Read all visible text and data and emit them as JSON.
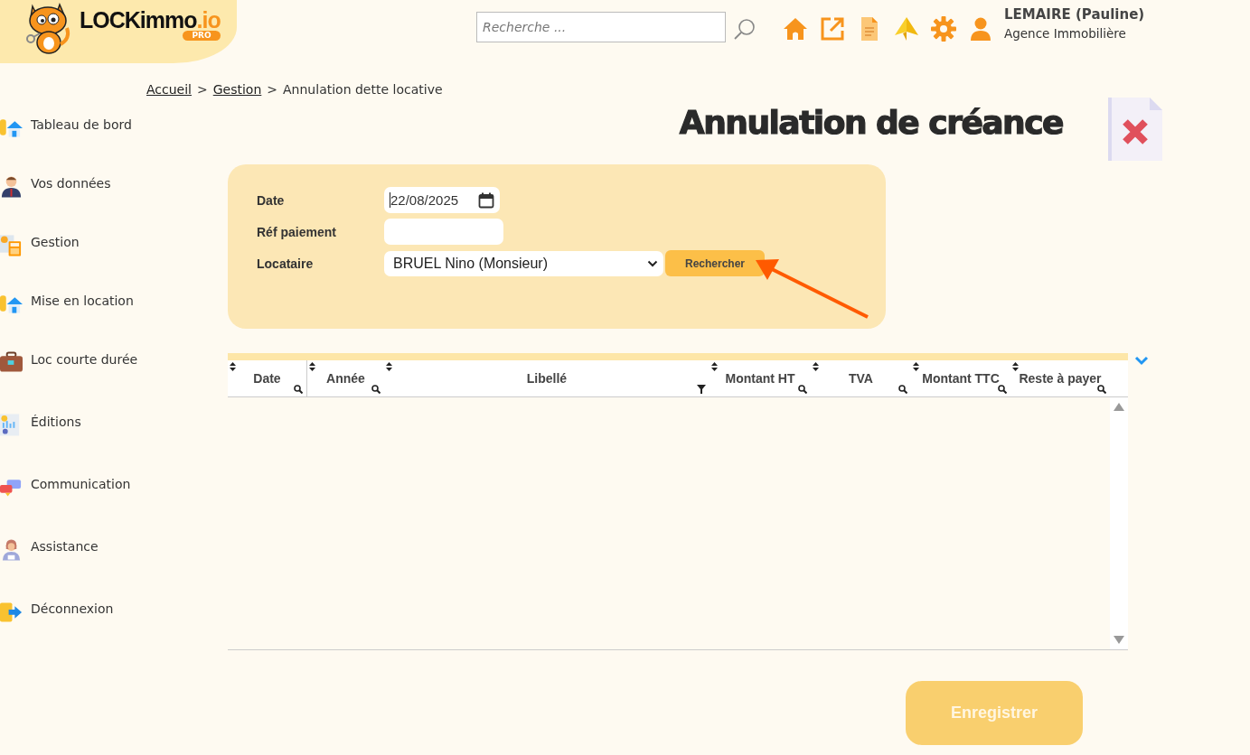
{
  "logo": {
    "name": "LOCKimmo",
    "suffix": ".io",
    "badge": "PRO"
  },
  "header": {
    "search": {
      "placeholder": "Recherche ..."
    },
    "user": {
      "name": "LEMAIRE (Pauline)",
      "role": "Agence Immobilière"
    }
  },
  "breadcrumb_separator": ">",
  "breadcrumb": [
    {
      "label": "Accueil",
      "link": true
    },
    {
      "label": "Gestion",
      "link": true
    },
    {
      "label": "Annulation dette locative",
      "link": false
    }
  ],
  "sidebar": {
    "items": [
      {
        "label": "Tableau de bord"
      },
      {
        "label": "Vos données"
      },
      {
        "label": "Gestion"
      },
      {
        "label": "Mise en location"
      },
      {
        "label": "Loc courte durée"
      },
      {
        "label": "Éditions"
      },
      {
        "label": "Communication"
      },
      {
        "label": "Assistance"
      },
      {
        "label": "Déconnexion"
      }
    ]
  },
  "page_title": "Annulation de créance",
  "form": {
    "fields": [
      {
        "kind": "date",
        "label": "Date",
        "value": "22/08/2025"
      },
      {
        "kind": "text",
        "label": "Réf paiement"
      },
      {
        "kind": "select",
        "label": "Locataire",
        "value": "BRUEL Nino (Monsieur)",
        "action": "Rechercher"
      }
    ]
  },
  "table": {
    "columns": [
      {
        "label": "Date",
        "kind": "search"
      },
      {
        "label": "Année",
        "kind": "search"
      },
      {
        "label": "Libellé",
        "kind": "filter"
      },
      {
        "label": "Montant HT",
        "kind": "search"
      },
      {
        "label": "TVA",
        "kind": "search"
      },
      {
        "label": "Montant TTC",
        "kind": "search"
      },
      {
        "label": "Reste à payer",
        "kind": "search"
      }
    ]
  },
  "save_button": "Enregistrer"
}
